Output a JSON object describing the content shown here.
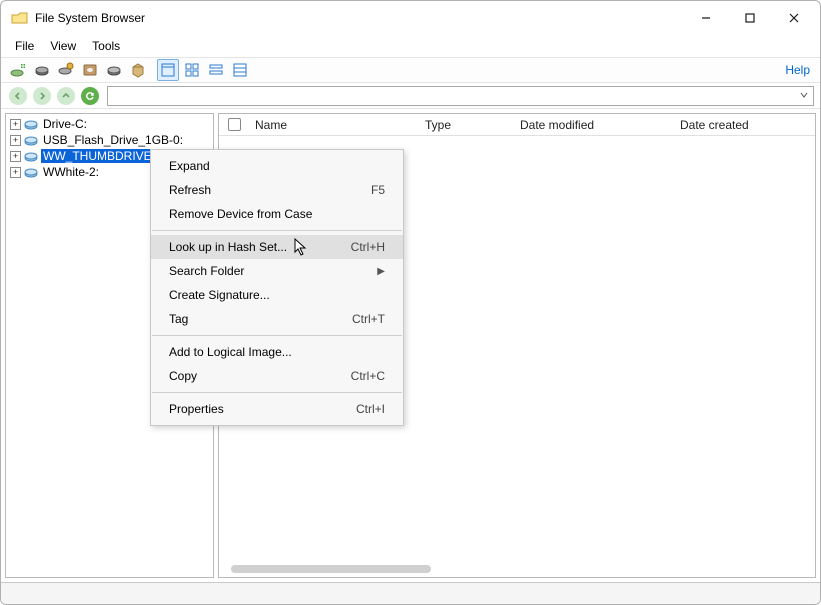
{
  "window": {
    "title": "File System Browser"
  },
  "menu": {
    "file": "File",
    "view": "View",
    "tools": "Tools"
  },
  "help": "Help",
  "tree": {
    "items": [
      {
        "label": "Drive-C:"
      },
      {
        "label": "USB_Flash_Drive_1GB-0:"
      },
      {
        "label": "WW_THUMBDRIVE:"
      },
      {
        "label": "WWhite-2:"
      }
    ]
  },
  "list": {
    "columns": {
      "name": "Name",
      "type": "Type",
      "date_modified": "Date modified",
      "date_created": "Date created"
    }
  },
  "context_menu": {
    "expand": "Expand",
    "refresh": "Refresh",
    "refresh_key": "F5",
    "remove": "Remove Device from Case",
    "lookup": "Look up in Hash Set...",
    "lookup_key": "Ctrl+H",
    "search": "Search Folder",
    "signature": "Create Signature...",
    "tag": "Tag",
    "tag_key": "Ctrl+T",
    "add_logical": "Add to Logical Image...",
    "copy": "Copy",
    "copy_key": "Ctrl+C",
    "properties": "Properties",
    "properties_key": "Ctrl+I"
  }
}
